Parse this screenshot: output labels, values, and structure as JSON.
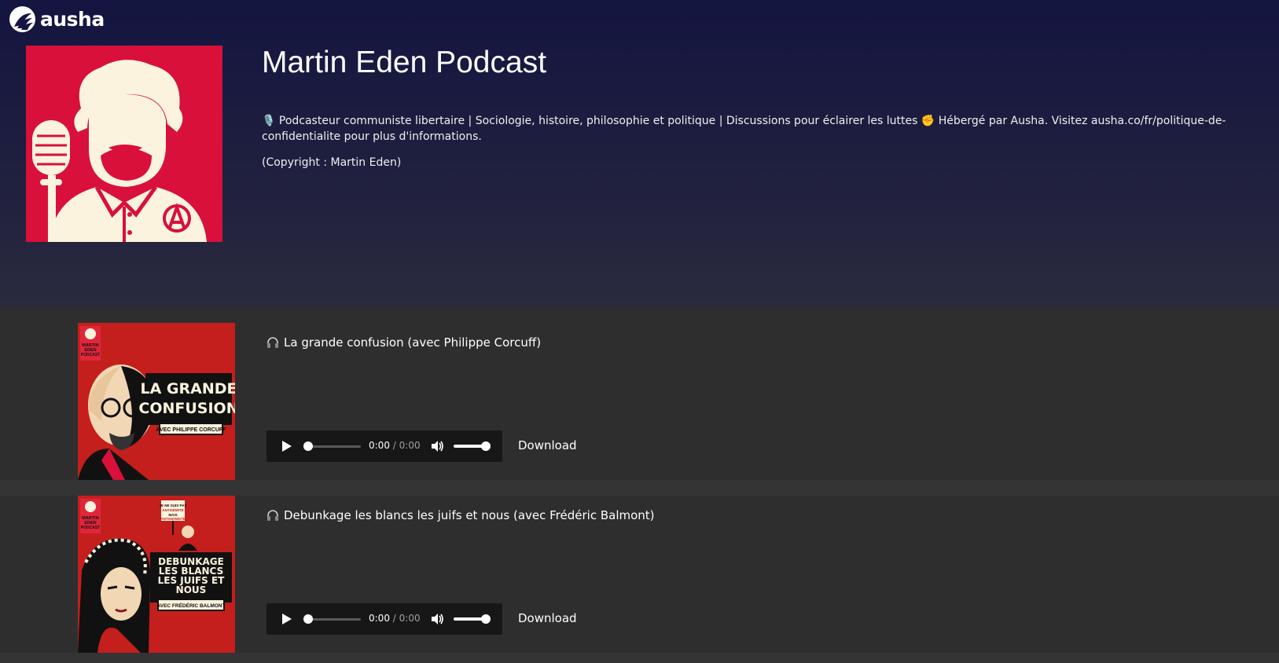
{
  "brand": {
    "name": "ausha",
    "logo_icon": "ausha-logo-icon"
  },
  "podcast": {
    "title": "Martin Eden Podcast",
    "description": "🎙️ Podcasteur communiste libertaire | Sociologie, histoire, philosophie et politique | Discussions pour éclairer les luttes ✊ Hébergé par Ausha. Visitez ausha.co/fr/politique-de-confidentialite pour plus d'informations.",
    "copyright": "(Copyright : Martin Eden)"
  },
  "episodes": [
    {
      "title": "La grande confusion (avec Philippe Corcuff)",
      "art_title": "LA GRANDE CONFUSION",
      "art_subtitle": "AVEC PHILIPPE CORCUFF",
      "art_badge": "MARTIN EDEN PODCAST",
      "player": {
        "current": "0:00",
        "separator": "/",
        "duration": "0:00"
      },
      "download_label": "Download"
    },
    {
      "title": "Debunkage les blancs les juifs et nous (avec Frédéric Balmont)",
      "art_title": "DEBUNKAGE LES BLANCS LES JUIFS ET NOUS",
      "art_subtitle": "AVEC FRÉDÉRIC BALMONT",
      "art_badge": "MARTIN EDEN PODCAST",
      "art_sign": "JE NE SUIS PAS ANTISÉMITE MAIS ANTISIONISTE",
      "player": {
        "current": "0:00",
        "separator": "/",
        "duration": "0:00"
      },
      "download_label": "Download"
    }
  ],
  "colors": {
    "header_top": "#141540",
    "page_bg": "#2e2e2e",
    "cover_red": "#d8103a",
    "cream": "#fbf3dd",
    "player_bg": "#171717"
  }
}
